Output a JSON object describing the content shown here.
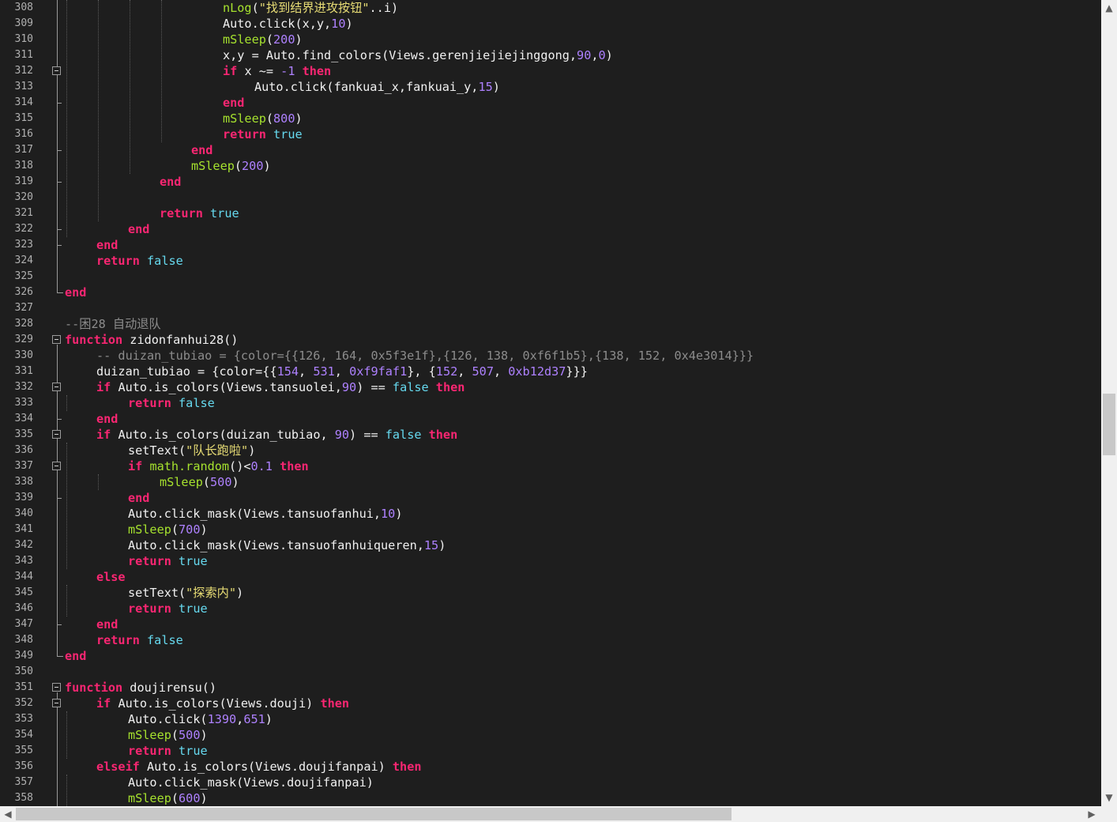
{
  "editor": {
    "first_line": 308,
    "line_numbers": [
      "308",
      "309",
      "310",
      "311",
      "312",
      "313",
      "314",
      "315",
      "316",
      "317",
      "318",
      "319",
      "320",
      "321",
      "322",
      "323",
      "324",
      "325",
      "326",
      "327",
      "328",
      "329",
      "330",
      "331",
      "332",
      "333",
      "334",
      "335",
      "336",
      "337",
      "338",
      "339",
      "340",
      "341",
      "342",
      "343",
      "344",
      "345",
      "346",
      "347",
      "348",
      "349",
      "350",
      "351",
      "352",
      "353",
      "354",
      "355",
      "356",
      "357",
      "358"
    ],
    "lines": [
      [
        [
          "fn",
          "nLog"
        ],
        [
          "op",
          "("
        ],
        [
          "str",
          "\"找到结界进攻按钮\""
        ],
        [
          "op",
          ".."
        ],
        [
          "id",
          "i"
        ],
        [
          "op",
          ")"
        ]
      ],
      [
        [
          "id",
          "Auto.click"
        ],
        [
          "op",
          "("
        ],
        [
          "id",
          "x,y,"
        ],
        [
          "num",
          "10"
        ],
        [
          "op",
          ")"
        ]
      ],
      [
        [
          "fn",
          "mSleep"
        ],
        [
          "op",
          "("
        ],
        [
          "num",
          "200"
        ],
        [
          "op",
          ")"
        ]
      ],
      [
        [
          "id",
          "x,y = Auto.find_colors(Views.gerenjiejiejinggong,"
        ],
        [
          "num",
          "90"
        ],
        [
          "id",
          ","
        ],
        [
          "num",
          "0"
        ],
        [
          "op",
          ")"
        ]
      ],
      [
        [
          "kw",
          "if"
        ],
        [
          "id",
          " x ~= "
        ],
        [
          "num",
          "-1"
        ],
        [
          "id",
          " "
        ],
        [
          "kw",
          "then"
        ]
      ],
      [
        [
          "id",
          "Auto.click(fankuai_x,fankuai_y,"
        ],
        [
          "num",
          "15"
        ],
        [
          "op",
          ")"
        ]
      ],
      [
        [
          "kw",
          "end"
        ]
      ],
      [
        [
          "fn",
          "mSleep"
        ],
        [
          "op",
          "("
        ],
        [
          "num",
          "800"
        ],
        [
          "op",
          ")"
        ]
      ],
      [
        [
          "kw",
          "return"
        ],
        [
          "id",
          " "
        ],
        [
          "bool",
          "true"
        ]
      ],
      [
        [
          "kw",
          "end"
        ]
      ],
      [
        [
          "fn",
          "mSleep"
        ],
        [
          "op",
          "("
        ],
        [
          "num",
          "200"
        ],
        [
          "op",
          ")"
        ]
      ],
      [
        [
          "kw",
          "end"
        ]
      ],
      [],
      [
        [
          "kw",
          "return"
        ],
        [
          "id",
          " "
        ],
        [
          "bool",
          "true"
        ]
      ],
      [
        [
          "kw",
          "end"
        ]
      ],
      [
        [
          "kw",
          "end"
        ]
      ],
      [
        [
          "kw",
          "return"
        ],
        [
          "id",
          " "
        ],
        [
          "bool",
          "false"
        ]
      ],
      [],
      [
        [
          "kw",
          "end"
        ]
      ],
      [],
      [
        [
          "cm",
          "--困28 自动退队"
        ]
      ],
      [
        [
          "kw",
          "function"
        ],
        [
          "id",
          " zidonfanhui28()"
        ]
      ],
      [
        [
          "cm",
          "-- duizan_tubiao = {color={{126, 164, 0x5f3e1f},{126, 138, 0xf6f1b5},{138, 152, 0x4e3014}}}"
        ]
      ],
      [
        [
          "id",
          "duizan_tubiao = {color={{"
        ],
        [
          "num",
          "154"
        ],
        [
          "id",
          ", "
        ],
        [
          "num",
          "531"
        ],
        [
          "id",
          ", "
        ],
        [
          "num",
          "0xf9faf1"
        ],
        [
          "id",
          "}, {"
        ],
        [
          "num",
          "152"
        ],
        [
          "id",
          ", "
        ],
        [
          "num",
          "507"
        ],
        [
          "id",
          ", "
        ],
        [
          "num",
          "0xb12d37"
        ],
        [
          "id",
          "}}}"
        ]
      ],
      [
        [
          "kw",
          "if"
        ],
        [
          "id",
          " Auto.is_colors(Views.tansuolei,"
        ],
        [
          "num",
          "90"
        ],
        [
          "id",
          ") == "
        ],
        [
          "bool",
          "false"
        ],
        [
          "id",
          " "
        ],
        [
          "kw",
          "then"
        ]
      ],
      [
        [
          "kw",
          "return"
        ],
        [
          "id",
          " "
        ],
        [
          "bool",
          "false"
        ]
      ],
      [
        [
          "kw",
          "end"
        ]
      ],
      [
        [
          "kw",
          "if"
        ],
        [
          "id",
          " Auto.is_colors(duizan_tubiao, "
        ],
        [
          "num",
          "90"
        ],
        [
          "id",
          ") == "
        ],
        [
          "bool",
          "false"
        ],
        [
          "id",
          " "
        ],
        [
          "kw",
          "then"
        ]
      ],
      [
        [
          "id",
          "setText("
        ],
        [
          "str",
          "\"队长跑啦\""
        ],
        [
          "id",
          ")"
        ]
      ],
      [
        [
          "kw",
          "if"
        ],
        [
          "id",
          " "
        ],
        [
          "fn",
          "math.random"
        ],
        [
          "id",
          "()<"
        ],
        [
          "num",
          "0.1"
        ],
        [
          "id",
          " "
        ],
        [
          "kw",
          "then"
        ]
      ],
      [
        [
          "fn",
          "mSleep"
        ],
        [
          "op",
          "("
        ],
        [
          "num",
          "500"
        ],
        [
          "op",
          ")"
        ]
      ],
      [
        [
          "kw",
          "end"
        ]
      ],
      [
        [
          "id",
          "Auto.click_mask(Views.tansuofanhui,"
        ],
        [
          "num",
          "10"
        ],
        [
          "op",
          ")"
        ]
      ],
      [
        [
          "fn",
          "mSleep"
        ],
        [
          "op",
          "("
        ],
        [
          "num",
          "700"
        ],
        [
          "op",
          ")"
        ]
      ],
      [
        [
          "id",
          "Auto.click_mask(Views.tansuofanhuiqueren,"
        ],
        [
          "num",
          "15"
        ],
        [
          "op",
          ")"
        ]
      ],
      [
        [
          "kw",
          "return"
        ],
        [
          "id",
          " "
        ],
        [
          "bool",
          "true"
        ]
      ],
      [
        [
          "kw",
          "else"
        ]
      ],
      [
        [
          "id",
          "setText("
        ],
        [
          "str",
          "\"探索内\""
        ],
        [
          "id",
          ")"
        ]
      ],
      [
        [
          "kw",
          "return"
        ],
        [
          "id",
          " "
        ],
        [
          "bool",
          "true"
        ]
      ],
      [
        [
          "kw",
          "end"
        ]
      ],
      [
        [
          "kw",
          "return"
        ],
        [
          "id",
          " "
        ],
        [
          "bool",
          "false"
        ]
      ],
      [
        [
          "kw",
          "end"
        ]
      ],
      [],
      [
        [
          "kw",
          "function"
        ],
        [
          "id",
          " doujirensu()"
        ]
      ],
      [
        [
          "kw",
          "if"
        ],
        [
          "id",
          " Auto.is_colors(Views.douji) "
        ],
        [
          "kw",
          "then"
        ]
      ],
      [
        [
          "id",
          "Auto.click("
        ],
        [
          "num",
          "1390"
        ],
        [
          "id",
          ","
        ],
        [
          "num",
          "651"
        ],
        [
          "op",
          ")"
        ]
      ],
      [
        [
          "fn",
          "mSleep"
        ],
        [
          "op",
          "("
        ],
        [
          "num",
          "500"
        ],
        [
          "op",
          ")"
        ]
      ],
      [
        [
          "kw",
          "return"
        ],
        [
          "id",
          " "
        ],
        [
          "bool",
          "true"
        ]
      ],
      [
        [
          "kw",
          "elseif"
        ],
        [
          "id",
          " Auto.is_colors(Views.doujifanpai) "
        ],
        [
          "kw",
          "then"
        ]
      ],
      [
        [
          "id",
          "Auto.click_mask(Views.doujifanpai)"
        ]
      ],
      [
        [
          "fn",
          "mSleep"
        ],
        [
          "op",
          "("
        ],
        [
          "num",
          "600"
        ],
        [
          "op",
          ")"
        ]
      ]
    ],
    "colors": {
      "background": "#1e1e1e",
      "keyword": "#f92672",
      "function": "#a6e22e",
      "number": "#ae81ff",
      "string": "#e6db74",
      "boolean": "#66d9ef",
      "comment": "#8c8c8c",
      "line_number": "#b0b0b0"
    }
  },
  "scrollbars": {
    "vertical": {
      "up_icon": "chevron-up-icon",
      "down_icon": "chevron-down-icon"
    },
    "horizontal": {
      "left_icon": "chevron-left-icon",
      "right_icon": "chevron-right-icon"
    }
  }
}
